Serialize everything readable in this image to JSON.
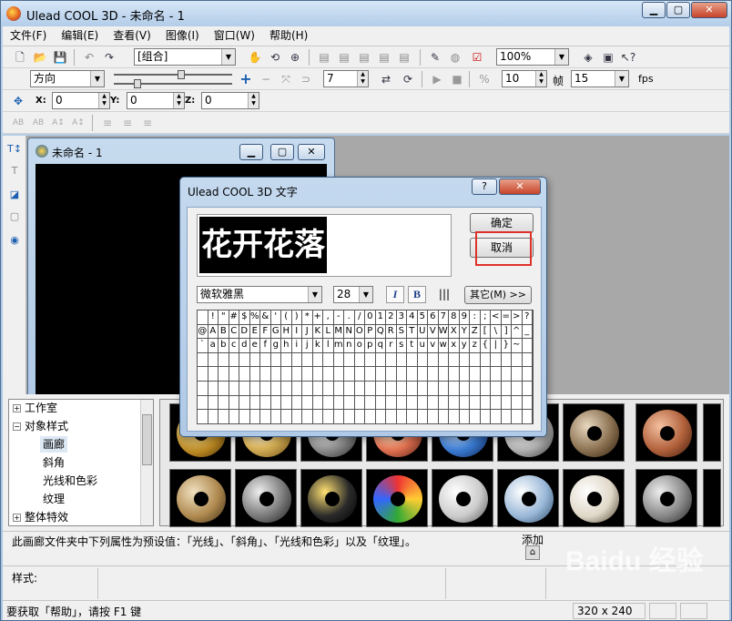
{
  "window": {
    "title": "Ulead COOL 3D - 未命名 - 1"
  },
  "menu": [
    "文件(F)",
    "编辑(E)",
    "查看(V)",
    "图像(I)",
    "窗口(W)",
    "帮助(H)"
  ],
  "toolbar1": {
    "object_select": "[组合]",
    "zoom": "100%"
  },
  "toolbar2": {
    "direction": "方向",
    "frame_value": "7",
    "speed_value": "10",
    "frames_label": "帧",
    "frames_value": "15",
    "fps_label": "fps"
  },
  "toolbar3": {
    "x_label": "X:",
    "x_value": "0",
    "y_label": "Y:",
    "y_value": "0",
    "z_label": "Z:",
    "z_value": "0"
  },
  "document": {
    "title": "未命名 - 1"
  },
  "dialog": {
    "title": "Ulead COOL 3D 文字",
    "preview_text": "花开花落",
    "ok_label": "确定",
    "cancel_label": "取消",
    "font_name": "微软雅黑",
    "font_size": "28",
    "italic_label": "I",
    "bold_label": "B",
    "other_label": "其它(M) >>",
    "char_rows": [
      [
        " ",
        "!",
        "\"",
        "#",
        "$",
        "%",
        "&",
        "'",
        "(",
        ")",
        "*",
        "+",
        ",",
        "-",
        ".",
        "/",
        "0",
        "1",
        "2",
        "3",
        "4",
        "5",
        "6",
        "7",
        "8",
        "9",
        ":",
        ";",
        "<",
        "=",
        ">",
        "?"
      ],
      [
        "@",
        "A",
        "B",
        "C",
        "D",
        "E",
        "F",
        "G",
        "H",
        "I",
        "J",
        "K",
        "L",
        "M",
        "N",
        "O",
        "P",
        "Q",
        "R",
        "S",
        "T",
        "U",
        "V",
        "W",
        "X",
        "Y",
        "Z",
        "[",
        "\\",
        "]",
        "^",
        "_"
      ],
      [
        "`",
        "a",
        "b",
        "c",
        "d",
        "e",
        "f",
        "g",
        "h",
        "i",
        "j",
        "k",
        "l",
        "m",
        "n",
        "o",
        "p",
        "q",
        "r",
        "s",
        "t",
        "u",
        "v",
        "w",
        "x",
        "y",
        "z",
        "{",
        "|",
        "}",
        "~",
        ""
      ]
    ]
  },
  "tree": [
    {
      "label": "工作室",
      "level": 0,
      "expander": "+"
    },
    {
      "label": "对象样式",
      "level": 0,
      "expander": "-"
    },
    {
      "label": "画廊",
      "level": 1,
      "selected": true
    },
    {
      "label": "斜角",
      "level": 1
    },
    {
      "label": "光线和色彩",
      "level": 1
    },
    {
      "label": "纹理",
      "level": 1
    },
    {
      "label": "整体特效",
      "level": 0,
      "expander": "+"
    }
  ],
  "description": "此画廊文件夹中下列属性为预设值：「光线」、「斜角」、「光线和色彩」以及「纹理」。",
  "add_label": "添加",
  "style_label": "样式:",
  "status": {
    "help": "要获取「帮助」，请按 F1 键",
    "size": "320 x 240"
  },
  "watermark": "Baidu 经验",
  "colors": {
    "accent_highlight": "#e0302a"
  }
}
